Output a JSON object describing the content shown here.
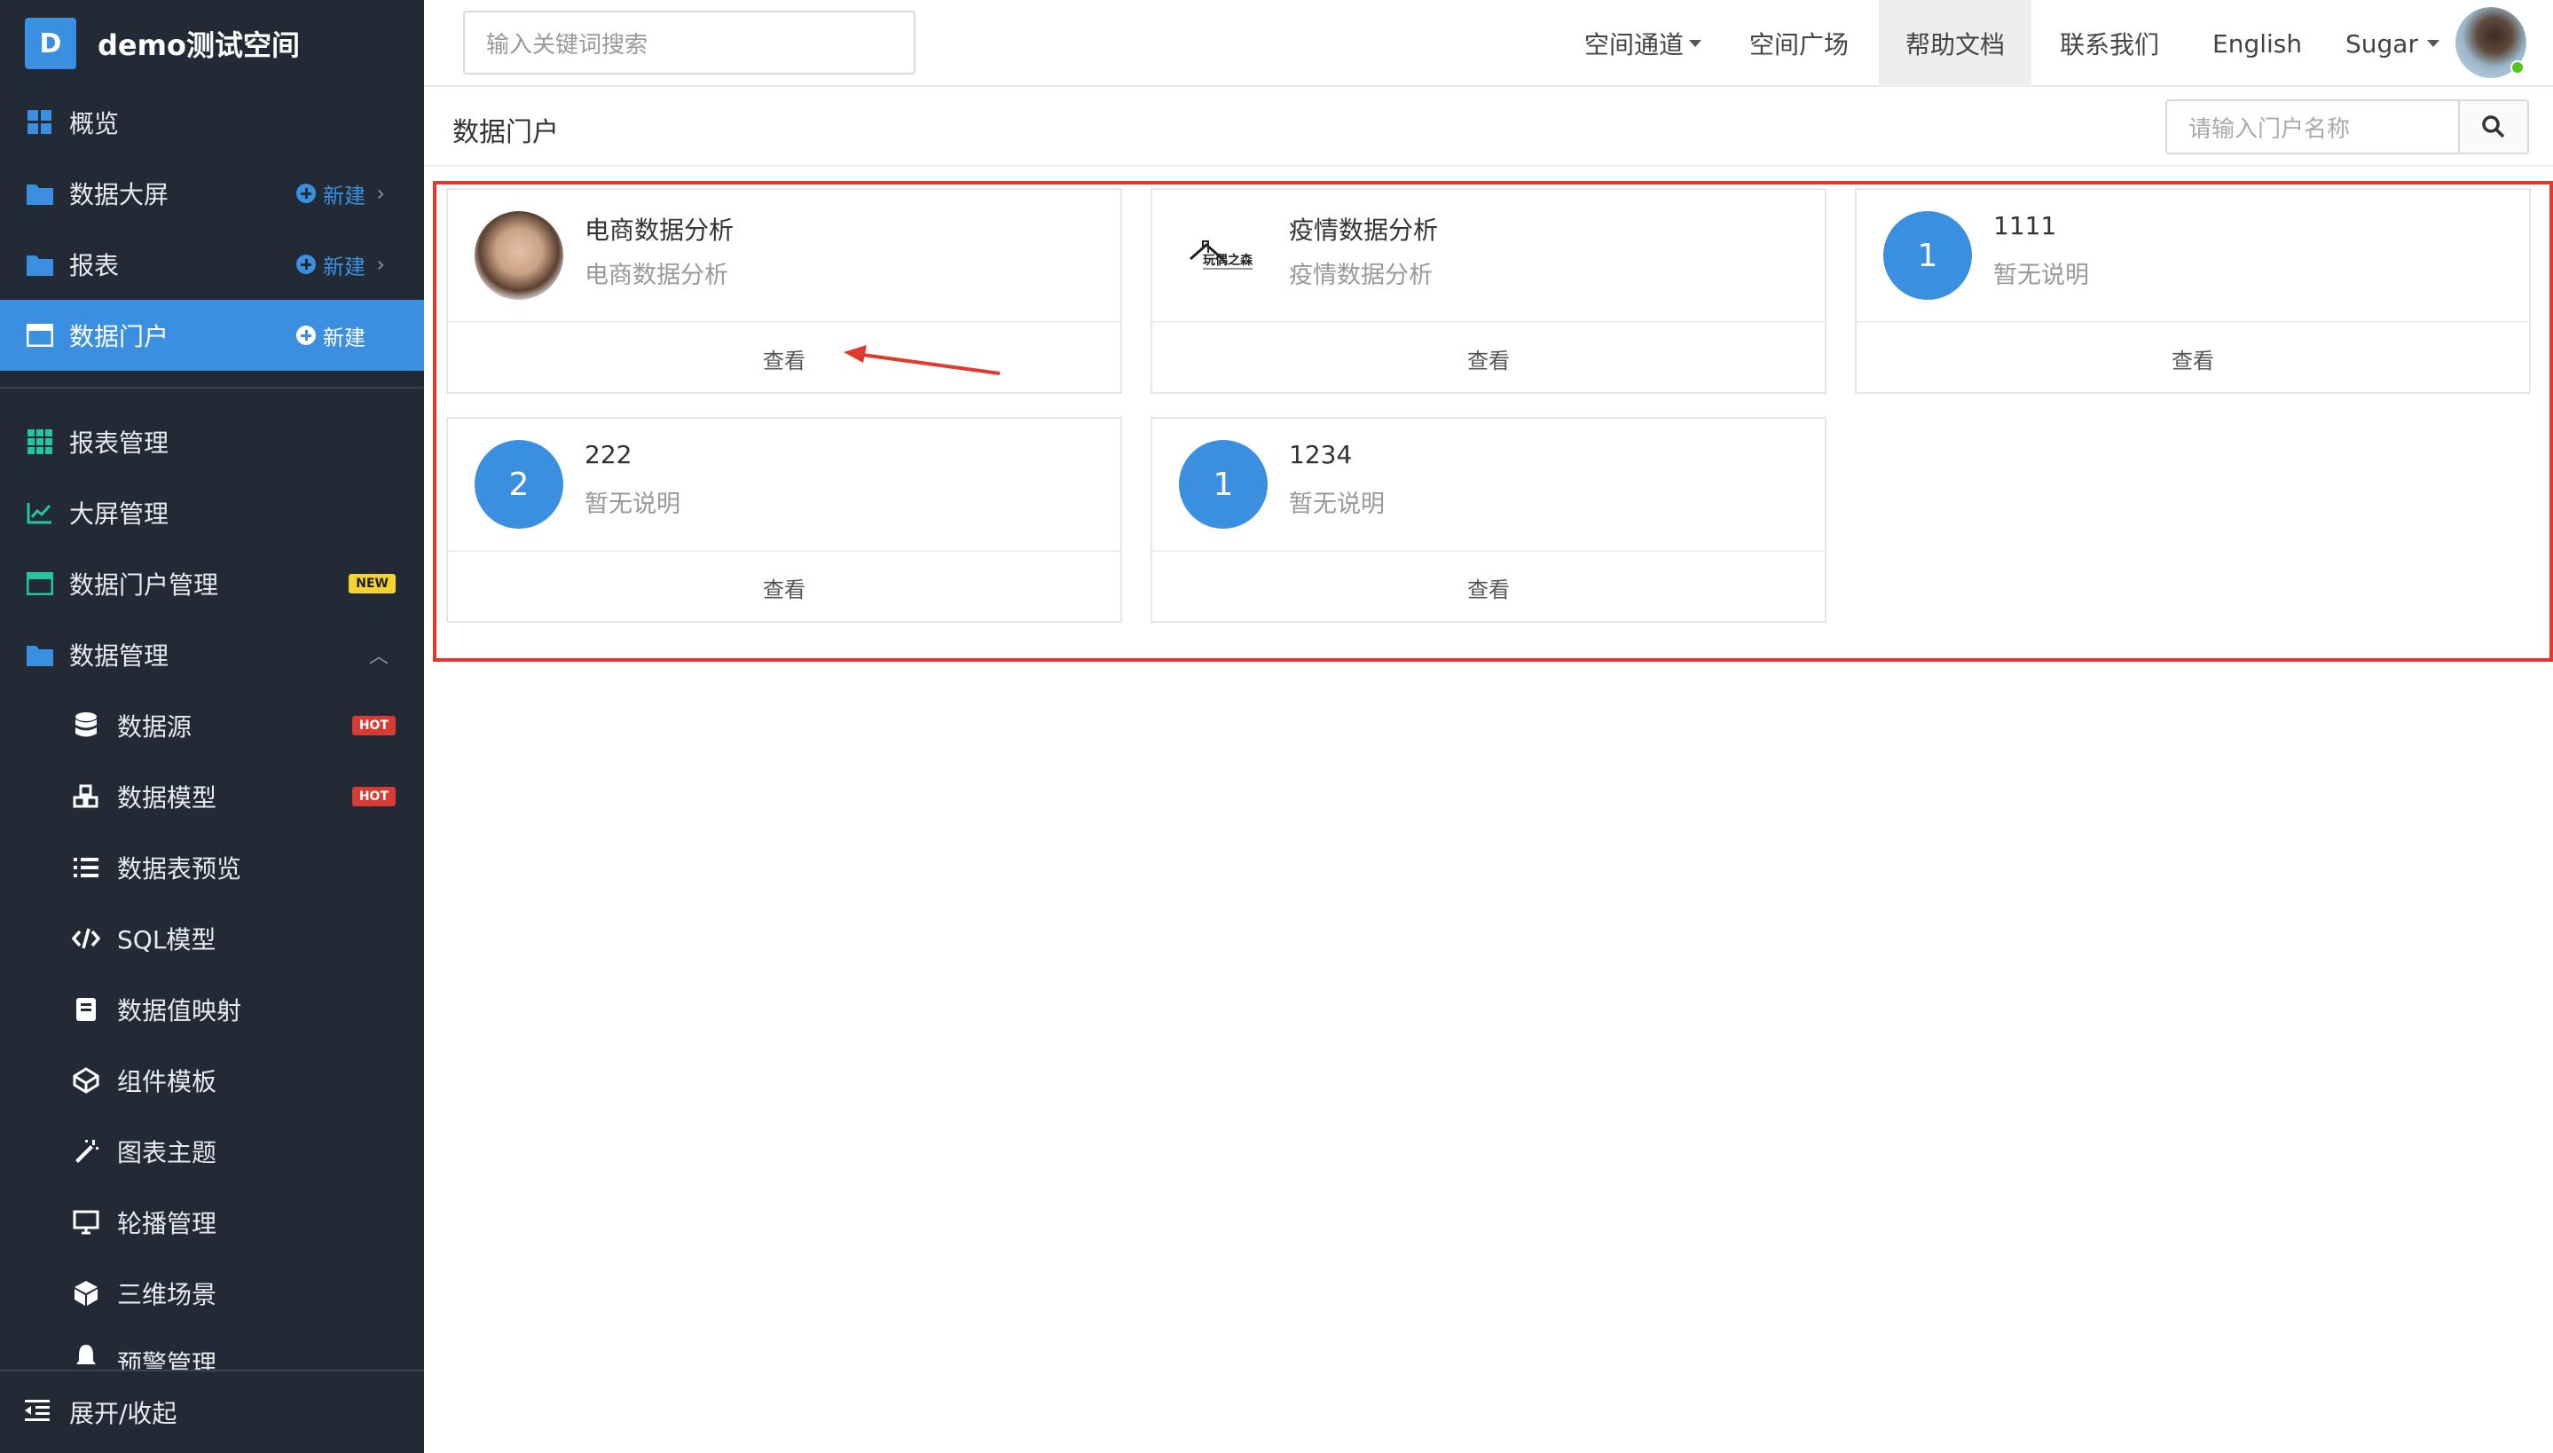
{
  "brand": {
    "logo_letter": "D",
    "name": "demo测试空间"
  },
  "sidebar": {
    "items": [
      {
        "label": "概览",
        "icon": "dashboard-icon"
      },
      {
        "label": "数据大屏",
        "icon": "folder-icon",
        "new_label": "新建"
      },
      {
        "label": "报表",
        "icon": "folder-icon",
        "new_label": "新建"
      },
      {
        "label": "数据门户",
        "icon": "window-icon",
        "new_label": "新建"
      },
      {
        "label": "报表管理",
        "icon": "grid-icon"
      },
      {
        "label": "大屏管理",
        "icon": "line-chart-icon"
      },
      {
        "label": "数据门户管理",
        "icon": "window-icon",
        "badge": "NEW"
      },
      {
        "label": "数据管理",
        "icon": "folder-icon"
      },
      {
        "label": "数据源",
        "icon": "database-icon",
        "badge": "HOT"
      },
      {
        "label": "数据模型",
        "icon": "cubes-icon",
        "badge": "HOT"
      },
      {
        "label": "数据表预览",
        "icon": "list-icon"
      },
      {
        "label": "SQL模型",
        "icon": "code-icon"
      },
      {
        "label": "数据值映射",
        "icon": "book-icon"
      },
      {
        "label": "组件模板",
        "icon": "codepen-icon"
      },
      {
        "label": "图表主题",
        "icon": "magic-wand-icon"
      },
      {
        "label": "轮播管理",
        "icon": "monitor-icon"
      },
      {
        "label": "三维场景",
        "icon": "cube-icon"
      },
      {
        "label": "预警管理",
        "icon": "bell-icon"
      }
    ],
    "collapse_label": "展开/收起"
  },
  "topbar": {
    "search_placeholder": "输入关键词搜索",
    "nav": [
      "空间通道",
      "空间广场",
      "帮助文档",
      "联系我们",
      "English",
      "Sugar"
    ]
  },
  "page": {
    "title": "数据门户",
    "portal_search_placeholder": "请输入门户名称"
  },
  "cards": [
    {
      "title": "电商数据分析",
      "desc": "电商数据分析",
      "thumb": "photo",
      "action": "查看"
    },
    {
      "title": "疫情数据分析",
      "desc": "疫情数据分析",
      "thumb": "logo",
      "logo_text": "玩偶之森",
      "action": "查看"
    },
    {
      "title": "1111",
      "desc": "暂无说明",
      "thumb": "1",
      "action": "查看"
    },
    {
      "title": "222",
      "desc": "暂无说明",
      "thumb": "2",
      "action": "查看"
    },
    {
      "title": "1234",
      "desc": "暂无说明",
      "thumb": "1",
      "action": "查看"
    }
  ],
  "colors": {
    "sidebar_bg": "#222b35",
    "accent": "#3b8fe0",
    "highlight": "#e2392f",
    "hot": "#d93a32",
    "new": "#f5d432"
  }
}
